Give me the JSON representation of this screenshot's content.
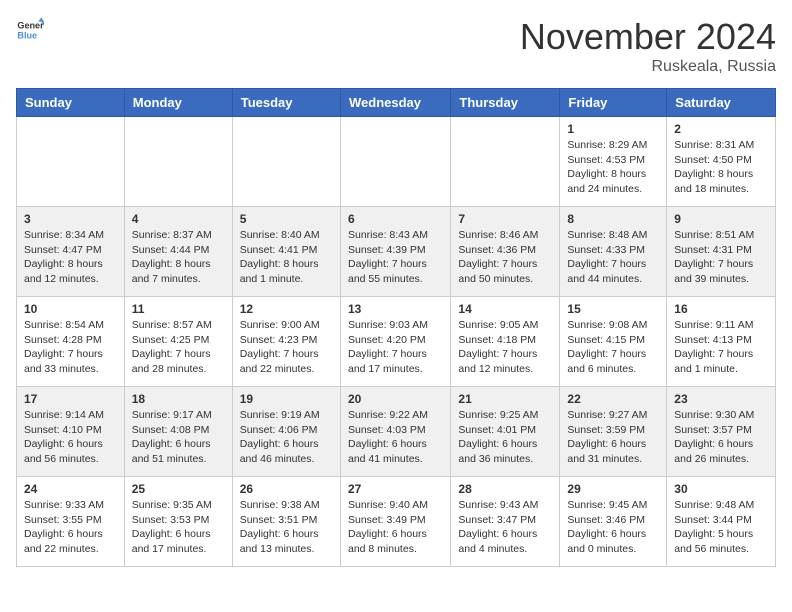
{
  "header": {
    "logo_general": "General",
    "logo_blue": "Blue",
    "month_title": "November 2024",
    "location": "Ruskeala, Russia"
  },
  "calendar": {
    "days_of_week": [
      "Sunday",
      "Monday",
      "Tuesday",
      "Wednesday",
      "Thursday",
      "Friday",
      "Saturday"
    ],
    "weeks": [
      [
        {
          "day": "",
          "sunrise": "",
          "sunset": "",
          "daylight": ""
        },
        {
          "day": "",
          "sunrise": "",
          "sunset": "",
          "daylight": ""
        },
        {
          "day": "",
          "sunrise": "",
          "sunset": "",
          "daylight": ""
        },
        {
          "day": "",
          "sunrise": "",
          "sunset": "",
          "daylight": ""
        },
        {
          "day": "",
          "sunrise": "",
          "sunset": "",
          "daylight": ""
        },
        {
          "day": "1",
          "sunrise": "Sunrise: 8:29 AM",
          "sunset": "Sunset: 4:53 PM",
          "daylight": "Daylight: 8 hours and 24 minutes."
        },
        {
          "day": "2",
          "sunrise": "Sunrise: 8:31 AM",
          "sunset": "Sunset: 4:50 PM",
          "daylight": "Daylight: 8 hours and 18 minutes."
        }
      ],
      [
        {
          "day": "3",
          "sunrise": "Sunrise: 8:34 AM",
          "sunset": "Sunset: 4:47 PM",
          "daylight": "Daylight: 8 hours and 12 minutes."
        },
        {
          "day": "4",
          "sunrise": "Sunrise: 8:37 AM",
          "sunset": "Sunset: 4:44 PM",
          "daylight": "Daylight: 8 hours and 7 minutes."
        },
        {
          "day": "5",
          "sunrise": "Sunrise: 8:40 AM",
          "sunset": "Sunset: 4:41 PM",
          "daylight": "Daylight: 8 hours and 1 minute."
        },
        {
          "day": "6",
          "sunrise": "Sunrise: 8:43 AM",
          "sunset": "Sunset: 4:39 PM",
          "daylight": "Daylight: 7 hours and 55 minutes."
        },
        {
          "day": "7",
          "sunrise": "Sunrise: 8:46 AM",
          "sunset": "Sunset: 4:36 PM",
          "daylight": "Daylight: 7 hours and 50 minutes."
        },
        {
          "day": "8",
          "sunrise": "Sunrise: 8:48 AM",
          "sunset": "Sunset: 4:33 PM",
          "daylight": "Daylight: 7 hours and 44 minutes."
        },
        {
          "day": "9",
          "sunrise": "Sunrise: 8:51 AM",
          "sunset": "Sunset: 4:31 PM",
          "daylight": "Daylight: 7 hours and 39 minutes."
        }
      ],
      [
        {
          "day": "10",
          "sunrise": "Sunrise: 8:54 AM",
          "sunset": "Sunset: 4:28 PM",
          "daylight": "Daylight: 7 hours and 33 minutes."
        },
        {
          "day": "11",
          "sunrise": "Sunrise: 8:57 AM",
          "sunset": "Sunset: 4:25 PM",
          "daylight": "Daylight: 7 hours and 28 minutes."
        },
        {
          "day": "12",
          "sunrise": "Sunrise: 9:00 AM",
          "sunset": "Sunset: 4:23 PM",
          "daylight": "Daylight: 7 hours and 22 minutes."
        },
        {
          "day": "13",
          "sunrise": "Sunrise: 9:03 AM",
          "sunset": "Sunset: 4:20 PM",
          "daylight": "Daylight: 7 hours and 17 minutes."
        },
        {
          "day": "14",
          "sunrise": "Sunrise: 9:05 AM",
          "sunset": "Sunset: 4:18 PM",
          "daylight": "Daylight: 7 hours and 12 minutes."
        },
        {
          "day": "15",
          "sunrise": "Sunrise: 9:08 AM",
          "sunset": "Sunset: 4:15 PM",
          "daylight": "Daylight: 7 hours and 6 minutes."
        },
        {
          "day": "16",
          "sunrise": "Sunrise: 9:11 AM",
          "sunset": "Sunset: 4:13 PM",
          "daylight": "Daylight: 7 hours and 1 minute."
        }
      ],
      [
        {
          "day": "17",
          "sunrise": "Sunrise: 9:14 AM",
          "sunset": "Sunset: 4:10 PM",
          "daylight": "Daylight: 6 hours and 56 minutes."
        },
        {
          "day": "18",
          "sunrise": "Sunrise: 9:17 AM",
          "sunset": "Sunset: 4:08 PM",
          "daylight": "Daylight: 6 hours and 51 minutes."
        },
        {
          "day": "19",
          "sunrise": "Sunrise: 9:19 AM",
          "sunset": "Sunset: 4:06 PM",
          "daylight": "Daylight: 6 hours and 46 minutes."
        },
        {
          "day": "20",
          "sunrise": "Sunrise: 9:22 AM",
          "sunset": "Sunset: 4:03 PM",
          "daylight": "Daylight: 6 hours and 41 minutes."
        },
        {
          "day": "21",
          "sunrise": "Sunrise: 9:25 AM",
          "sunset": "Sunset: 4:01 PM",
          "daylight": "Daylight: 6 hours and 36 minutes."
        },
        {
          "day": "22",
          "sunrise": "Sunrise: 9:27 AM",
          "sunset": "Sunset: 3:59 PM",
          "daylight": "Daylight: 6 hours and 31 minutes."
        },
        {
          "day": "23",
          "sunrise": "Sunrise: 9:30 AM",
          "sunset": "Sunset: 3:57 PM",
          "daylight": "Daylight: 6 hours and 26 minutes."
        }
      ],
      [
        {
          "day": "24",
          "sunrise": "Sunrise: 9:33 AM",
          "sunset": "Sunset: 3:55 PM",
          "daylight": "Daylight: 6 hours and 22 minutes."
        },
        {
          "day": "25",
          "sunrise": "Sunrise: 9:35 AM",
          "sunset": "Sunset: 3:53 PM",
          "daylight": "Daylight: 6 hours and 17 minutes."
        },
        {
          "day": "26",
          "sunrise": "Sunrise: 9:38 AM",
          "sunset": "Sunset: 3:51 PM",
          "daylight": "Daylight: 6 hours and 13 minutes."
        },
        {
          "day": "27",
          "sunrise": "Sunrise: 9:40 AM",
          "sunset": "Sunset: 3:49 PM",
          "daylight": "Daylight: 6 hours and 8 minutes."
        },
        {
          "day": "28",
          "sunrise": "Sunrise: 9:43 AM",
          "sunset": "Sunset: 3:47 PM",
          "daylight": "Daylight: 6 hours and 4 minutes."
        },
        {
          "day": "29",
          "sunrise": "Sunrise: 9:45 AM",
          "sunset": "Sunset: 3:46 PM",
          "daylight": "Daylight: 6 hours and 0 minutes."
        },
        {
          "day": "30",
          "sunrise": "Sunrise: 9:48 AM",
          "sunset": "Sunset: 3:44 PM",
          "daylight": "Daylight: 5 hours and 56 minutes."
        }
      ]
    ]
  }
}
